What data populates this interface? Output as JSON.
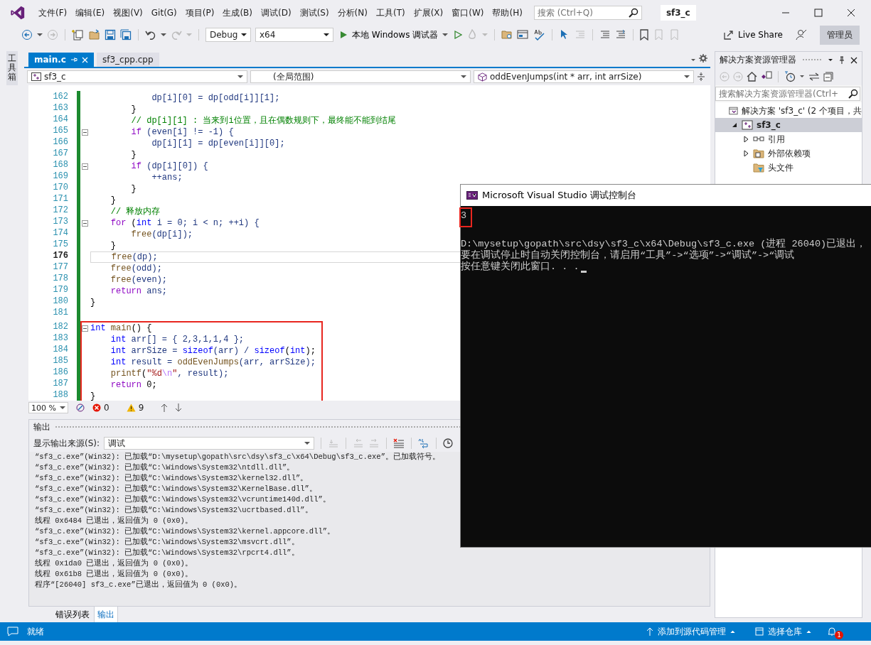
{
  "window": {
    "title": "sf3_c"
  },
  "menu": [
    "文件(F)",
    "编辑(E)",
    "视图(V)",
    "Git(G)",
    "项目(P)",
    "生成(B)",
    "调试(D)",
    "测试(S)",
    "分析(N)",
    "工具(T)",
    "扩展(X)",
    "窗口(W)",
    "帮助(H)"
  ],
  "search": {
    "placeholder": "搜索 (Ctrl+Q)"
  },
  "toolbar": {
    "configuration": "Debug",
    "platform": "x64",
    "run_label": "本地 Windows 调试器",
    "live_share": "Live Share",
    "role_badge": "管理员"
  },
  "toolbox_label": "工具箱",
  "editor": {
    "tabs": [
      {
        "label": "main.c",
        "selected": true
      },
      {
        "label": "sf3_cpp.cpp",
        "selected": false
      }
    ],
    "nav": {
      "project": "sf3_c",
      "scope": "(全局范围)",
      "member": "oddEvenJumps(int * arr, int arrSize)"
    },
    "blocks": [
      {
        "highlighted": false,
        "lines": [
          {
            "number": "162",
            "fold": false,
            "current": false,
            "tokens": [
              {
                "kind": "var",
                "text": "            dp[i][0] = dp[odd[i]][1];"
              }
            ]
          },
          {
            "number": "163",
            "fold": false,
            "current": false,
            "tokens": [
              {
                "kind": "plain",
                "text": "        }"
              }
            ]
          },
          {
            "number": "164",
            "fold": false,
            "current": false,
            "tokens": [
              {
                "kind": "cmt",
                "text": "        // dp[i][1] : 当来到i位置，且在偶数规则下，最终能不能到结尾"
              }
            ]
          },
          {
            "number": "165",
            "fold": true,
            "current": false,
            "tokens": [
              {
                "kind": "ctl",
                "text": "        if"
              },
              {
                "kind": "var",
                "text": " (even[i] != -1) {"
              }
            ]
          },
          {
            "number": "166",
            "fold": false,
            "current": false,
            "tokens": [
              {
                "kind": "var",
                "text": "            dp[i][1] = dp[even[i]][0];"
              }
            ]
          },
          {
            "number": "167",
            "fold": false,
            "current": false,
            "tokens": [
              {
                "kind": "plain",
                "text": "        }"
              }
            ]
          },
          {
            "number": "168",
            "fold": true,
            "current": false,
            "tokens": [
              {
                "kind": "ctl",
                "text": "        if"
              },
              {
                "kind": "var",
                "text": " (dp[i][0]) {"
              }
            ]
          },
          {
            "number": "169",
            "fold": false,
            "current": false,
            "tokens": [
              {
                "kind": "var",
                "text": "            ++ans;"
              }
            ]
          },
          {
            "number": "170",
            "fold": false,
            "current": false,
            "tokens": [
              {
                "kind": "plain",
                "text": "        }"
              }
            ]
          },
          {
            "number": "171",
            "fold": false,
            "current": false,
            "tokens": [
              {
                "kind": "plain",
                "text": "    }"
              }
            ]
          },
          {
            "number": "172",
            "fold": false,
            "current": false,
            "tokens": [
              {
                "kind": "cmt",
                "text": "    // 释放内存"
              }
            ]
          },
          {
            "number": "173",
            "fold": true,
            "current": false,
            "tokens": [
              {
                "kind": "ctl",
                "text": "    for"
              },
              {
                "kind": "plain",
                "text": " ("
              },
              {
                "kind": "kw",
                "text": "int"
              },
              {
                "kind": "var",
                "text": " i = 0; i < n; ++i) {"
              }
            ]
          },
          {
            "number": "174",
            "fold": false,
            "current": false,
            "tokens": [
              {
                "kind": "fn",
                "text": "        free"
              },
              {
                "kind": "var",
                "text": "(dp[i]);"
              }
            ]
          },
          {
            "number": "175",
            "fold": false,
            "current": false,
            "tokens": [
              {
                "kind": "plain",
                "text": "    }"
              }
            ]
          },
          {
            "number": "176",
            "fold": false,
            "current": true,
            "tokens": [
              {
                "kind": "fn",
                "text": "    free"
              },
              {
                "kind": "var",
                "text": "(dp);"
              }
            ]
          },
          {
            "number": "177",
            "fold": false,
            "current": false,
            "tokens": [
              {
                "kind": "fn",
                "text": "    free"
              },
              {
                "kind": "var",
                "text": "(odd);"
              }
            ]
          },
          {
            "number": "178",
            "fold": false,
            "current": false,
            "tokens": [
              {
                "kind": "fn",
                "text": "    free"
              },
              {
                "kind": "var",
                "text": "(even);"
              }
            ]
          },
          {
            "number": "179",
            "fold": false,
            "current": false,
            "tokens": [
              {
                "kind": "ctl",
                "text": "    return"
              },
              {
                "kind": "var",
                "text": " ans;"
              }
            ]
          },
          {
            "number": "180",
            "fold": false,
            "current": false,
            "tokens": [
              {
                "kind": "plain",
                "text": "}"
              }
            ]
          },
          {
            "number": "181",
            "fold": false,
            "current": false
          }
        ]
      },
      {
        "highlighted": true,
        "lines": [
          {
            "number": "182",
            "fold": true,
            "current": false,
            "tokens": [
              {
                "kind": "kw",
                "text": "int"
              },
              {
                "kind": "fn",
                "text": " main"
              },
              {
                "kind": "plain",
                "text": "() {"
              }
            ]
          },
          {
            "number": "183",
            "fold": false,
            "current": false,
            "tokens": [
              {
                "kind": "kw",
                "text": "    int"
              },
              {
                "kind": "var",
                "text": " arr[] = { 2,3,1,1,4 };"
              }
            ]
          },
          {
            "number": "184",
            "fold": false,
            "current": false,
            "tokens": [
              {
                "kind": "kw",
                "text": "    int"
              },
              {
                "kind": "var",
                "text": " arrSize = "
              },
              {
                "kind": "kw",
                "text": "sizeof"
              },
              {
                "kind": "var",
                "text": "(arr) / "
              },
              {
                "kind": "kw",
                "text": "sizeof"
              },
              {
                "kind": "plain",
                "text": "("
              },
              {
                "kind": "kw",
                "text": "int"
              },
              {
                "kind": "plain",
                "text": ");"
              }
            ]
          },
          {
            "number": "185",
            "fold": false,
            "current": false,
            "tokens": [
              {
                "kind": "kw",
                "text": "    int"
              },
              {
                "kind": "var",
                "text": " result = "
              },
              {
                "kind": "fn",
                "text": "oddEvenJumps"
              },
              {
                "kind": "var",
                "text": "(arr, arrSize);"
              }
            ]
          },
          {
            "number": "186",
            "fold": false,
            "current": false,
            "tokens": [
              {
                "kind": "fn",
                "text": "    printf"
              },
              {
                "kind": "plain",
                "text": "("
              },
              {
                "kind": "str",
                "text": "\"%d"
              },
              {
                "kind": "esc",
                "text": "\\n"
              },
              {
                "kind": "str",
                "text": "\""
              },
              {
                "kind": "var",
                "text": ", result);"
              }
            ]
          },
          {
            "number": "187",
            "fold": false,
            "current": false,
            "tokens": [
              {
                "kind": "ctl",
                "text": "    return"
              },
              {
                "kind": "plain",
                "text": " 0;"
              }
            ]
          },
          {
            "number": "188",
            "fold": false,
            "current": false,
            "tokens": [
              {
                "kind": "plain",
                "text": "}"
              }
            ]
          }
        ]
      }
    ],
    "zoom": "100 %",
    "errors": "0",
    "warnings": "9"
  },
  "output": {
    "title": "输出",
    "source_label": "显示输出来源(S):",
    "source": "调试",
    "lines": [
      "“sf3_c.exe”(Win32): 已加载“D:\\mysetup\\gopath\\src\\dsy\\sf3_c\\x64\\Debug\\sf3_c.exe”。已加载符号。",
      "“sf3_c.exe”(Win32): 已加载“C:\\Windows\\System32\\ntdll.dll”。",
      "“sf3_c.exe”(Win32): 已加载“C:\\Windows\\System32\\kernel32.dll”。",
      "“sf3_c.exe”(Win32): 已加载“C:\\Windows\\System32\\KernelBase.dll”。",
      "“sf3_c.exe”(Win32): 已加载“C:\\Windows\\System32\\vcruntime140d.dll”。",
      "“sf3_c.exe”(Win32): 已加载“C:\\Windows\\System32\\ucrtbased.dll”。",
      "线程 0x6484 已退出，返回值为 0 (0x0)。",
      "“sf3_c.exe”(Win32): 已加载“C:\\Windows\\System32\\kernel.appcore.dll”。",
      "“sf3_c.exe”(Win32): 已加载“C:\\Windows\\System32\\msvcrt.dll”。",
      "“sf3_c.exe”(Win32): 已加载“C:\\Windows\\System32\\rpcrt4.dll”。",
      "线程 0x1da0 已退出，返回值为 0 (0x0)。",
      "线程 0x61b8 已退出，返回值为 0 (0x0)。",
      "程序“[26040] sf3_c.exe”已退出，返回值为 0 (0x0)。"
    ]
  },
  "bottom_tabs": [
    {
      "label": "错误列表",
      "selected": false
    },
    {
      "label": "输出",
      "selected": true
    }
  ],
  "solution_explorer": {
    "title": "解决方案资源管理器",
    "search_placeholder": "搜索解决方案资源管理器(Ctrl+",
    "tree": [
      {
        "label": "解决方案 'sf3_c' (2 个项目，共",
        "kind": "solution",
        "selected": false,
        "children": [
          {
            "label": "sf3_c",
            "kind": "project",
            "expanded": true,
            "selected": true,
            "children": [
              {
                "label": "引用",
                "kind": "references",
                "expanded": false,
                "selected": false
              },
              {
                "label": "外部依赖项",
                "kind": "dependencies",
                "expanded": false,
                "selected": false
              },
              {
                "label": "头文件",
                "kind": "filter",
                "selected": false
              }
            ]
          }
        ]
      }
    ]
  },
  "console": {
    "title": "Microsoft Visual Studio 调试控制台",
    "cursor": true,
    "lines": [
      {
        "kind": "output",
        "highlighted": true,
        "text": "3"
      },
      {
        "kind": "message",
        "highlighted": false,
        "text": "D:\\mysetup\\gopath\\src\\dsy\\sf3_c\\x64\\Debug\\sf3_c.exe (进程 26040)已退出，"
      },
      {
        "kind": "message",
        "highlighted": false,
        "text": "要在调试停止时自动关闭控制台，请启用“工具”->“选项”->“调试”->“调试"
      },
      {
        "kind": "message",
        "highlighted": false,
        "text": "按任意键关闭此窗口. . ."
      }
    ]
  },
  "status_bar": {
    "text": "就绪",
    "source_control": "添加到源代码管理",
    "repository": "选择仓库",
    "notifications": "1"
  }
}
